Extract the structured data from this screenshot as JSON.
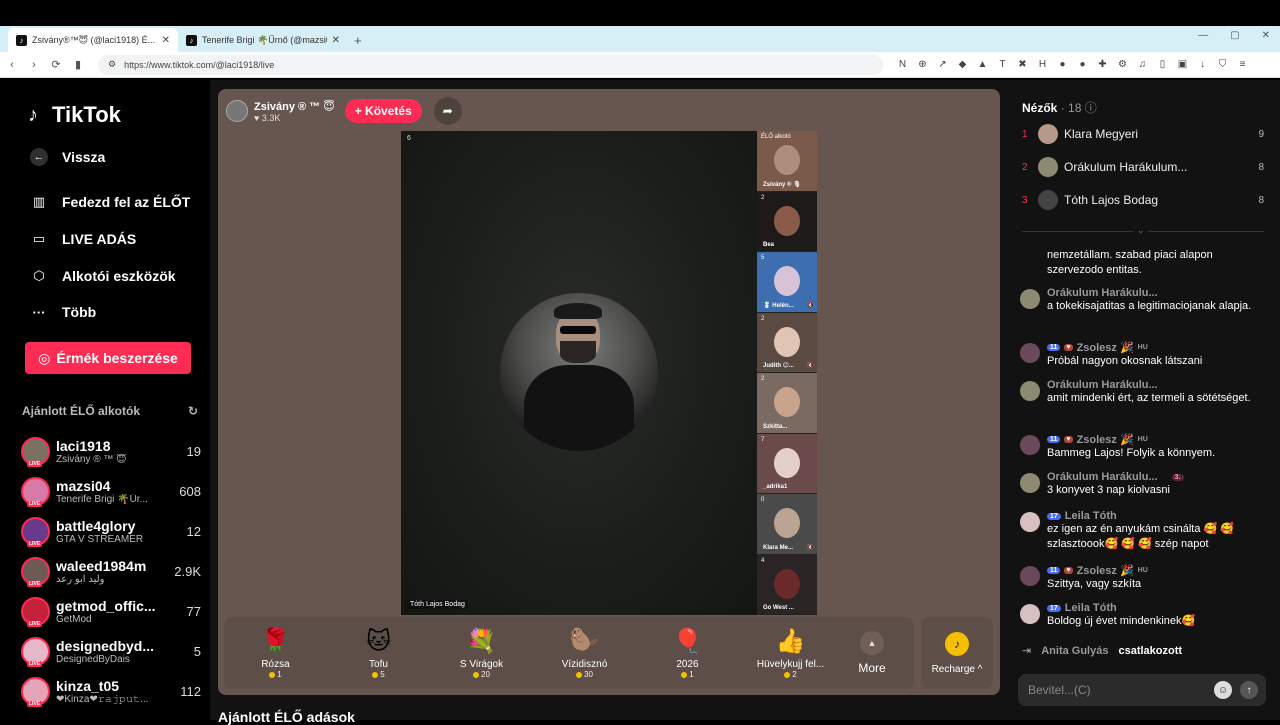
{
  "browser": {
    "tabs": [
      {
        "title": "Zsivány®™😇 (@laci1918) É...",
        "active": true
      },
      {
        "title": "Tenerife Brigi 🌴Űrnő (@mazsi04) É...",
        "active": false
      }
    ],
    "url": "https://www.tiktok.com/@laci1918/live",
    "win_min": "—",
    "win_max": "▢",
    "win_close": "✕"
  },
  "sidebar": {
    "logo": "TikTok",
    "back": "Vissza",
    "nav": [
      {
        "label": "Fedezd fel az ÉLŐT",
        "icon": "explore-live-icon"
      },
      {
        "label": "LIVE ADÁS",
        "icon": "camera-icon"
      },
      {
        "label": "Alkotói eszközök",
        "icon": "creator-tools-icon"
      },
      {
        "label": "Több",
        "icon": "more-dots-icon"
      }
    ],
    "coins_button": "Érmék beszerzése",
    "recommended_title": "Ajánlott ÉLŐ alkotók",
    "creators": [
      {
        "name": "laci1918",
        "sub": "Zsivány ® ™ 😇",
        "count": "19"
      },
      {
        "name": "mazsi04",
        "sub": "Tenerife Brigi 🌴Űr...",
        "count": "608"
      },
      {
        "name": "battle4glory",
        "sub": "GTA V STREAMER",
        "count": "12"
      },
      {
        "name": "waleed1984m",
        "sub": "وليد ابو رعد",
        "count": "2.9K"
      },
      {
        "name": "getmod_offic...",
        "sub": "GetMod",
        "count": "77"
      },
      {
        "name": "designedbyd...",
        "sub": "DesignedByDais",
        "count": "5"
      },
      {
        "name": "kinza_t05",
        "sub": "❤Kinza❤𝚛𝚊𝚓𝚙𝚞𝚝...",
        "count": "112"
      }
    ]
  },
  "stage": {
    "host_name": "Zsivány ® ™ 😇",
    "host_likes": "♥ 3.3K",
    "follow_label": "+ Követés",
    "video_viewers": "6",
    "video_caption": "Tóth Lajos Bodag",
    "guests": [
      {
        "num": "",
        "name": "Zsivány ® 🎙",
        "top_tag": "ÉLŐ alkotó"
      },
      {
        "num": "2",
        "name": "Bea"
      },
      {
        "num": "5",
        "name": "🎖 Helén..."
      },
      {
        "num": "2",
        "name": "Judith 😊..."
      },
      {
        "num": "2",
        "name": "Szkitta..."
      },
      {
        "num": "7",
        "name": "_adrika1"
      },
      {
        "num": "0",
        "name": "Klara Me..."
      },
      {
        "num": "4",
        "name": "Go West ..."
      }
    ],
    "gifts": [
      {
        "name": "Rózsa",
        "price": "1",
        "icon": "🌹"
      },
      {
        "name": "Tofu",
        "price": "5",
        "icon": "🐱"
      },
      {
        "name": "S Virágok",
        "price": "20",
        "icon": "💐"
      },
      {
        "name": "Vízidisznó",
        "price": "30",
        "icon": "🦫"
      },
      {
        "name": "2026",
        "price": "1",
        "icon": "🎈"
      },
      {
        "name": "Hüvelykujj fel...",
        "price": "2",
        "icon": "👍"
      }
    ],
    "more_label": "More",
    "recharge_label": "Recharge ^",
    "recommended_lives": "Ajánlott ÉLŐ adások"
  },
  "rpanel": {
    "viewers_title": "Nézők",
    "viewers_count": "· 18",
    "viewers": [
      {
        "rank": "1",
        "name": "Klara Megyeri",
        "score": "9"
      },
      {
        "rank": "2",
        "name": "Orákulum Harákulum...",
        "score": "8"
      },
      {
        "rank": "3",
        "name": "Tóth Lajos Bodag",
        "score": "8"
      }
    ],
    "messages": [
      {
        "name": "",
        "text": "nemzetállam. szabad piaci alapon szervezodo entitas.",
        "badges": ""
      },
      {
        "name": "Orákulum Harákulu...",
        "text": "a tokekisajatitas a legitimaciojanak alapja.",
        "badges": ""
      },
      {
        "name": "Zsolesz 🎉",
        "text": "Próbál nagyon okosnak látszani",
        "lvl": "11",
        "hu": "HU"
      },
      {
        "name": "Orákulum Harákulu...",
        "text": "amit mindenki ért, az termeli a sötétséget.",
        "badges": ""
      },
      {
        "name": "Zsolesz 🎉",
        "text": "Bammeg Lajos! Folyik a könnyem.",
        "lvl": "11",
        "hu": "HU"
      },
      {
        "name": "Orákulum Harákulu...",
        "text": "3 konyvet 3 nap kiolvasni",
        "pink": "3."
      },
      {
        "name": "Leila Tóth",
        "text": "ez igen az én anyukám csinálta 🥰 🥰 szlasztoook🥰 🥰 🥰 szép napot",
        "lvl": "17"
      },
      {
        "name": "Zsolesz 🎉",
        "text": "Szittya, vagy szkíta",
        "lvl": "11",
        "hu": "HU"
      },
      {
        "name": "Leila Tóth",
        "text": "Boldog új évet mindenkinek🥰",
        "lvl": "17"
      }
    ],
    "join_name": "Anita Gulyás",
    "join_action": "csatlakozott",
    "input_placeholder": "Bevitel...(C)"
  }
}
